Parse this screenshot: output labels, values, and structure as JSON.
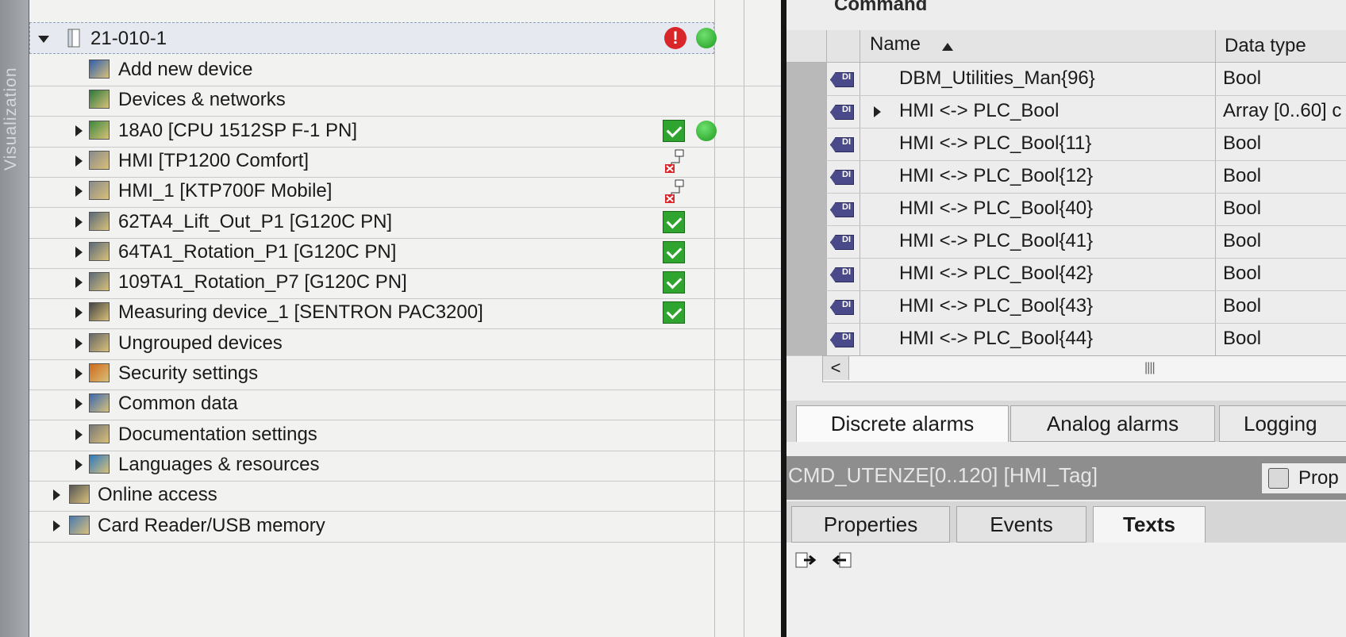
{
  "sidebar": {
    "vertical_label": "Visualization"
  },
  "tree": {
    "root": {
      "label": "21-010-1",
      "expanded": true,
      "status_error_icon": "error-icon",
      "status_online_icon": "green-dot-icon"
    },
    "items": [
      {
        "label": "Add new device",
        "icon": "add-device-icon",
        "arrow": false,
        "indent": 1,
        "status": ""
      },
      {
        "label": "Devices & networks",
        "icon": "network-icon",
        "arrow": false,
        "indent": 1,
        "status": ""
      },
      {
        "label": "18A0 [CPU 1512SP F-1 PN]",
        "icon": "cpu-icon",
        "arrow": true,
        "indent": 1,
        "status": "check-green"
      },
      {
        "label": "HMI [TP1200 Comfort]",
        "icon": "hmi-icon",
        "arrow": true,
        "indent": 1,
        "status": "net-error"
      },
      {
        "label": "HMI_1 [KTP700F Mobile]",
        "icon": "hmi-icon",
        "arrow": true,
        "indent": 1,
        "status": "net-error"
      },
      {
        "label": "62TA4_Lift_Out_P1 [G120C PN]",
        "icon": "drive-icon",
        "arrow": true,
        "indent": 1,
        "status": "check"
      },
      {
        "label": "64TA1_Rotation_P1 [G120C PN]",
        "icon": "drive-icon",
        "arrow": true,
        "indent": 1,
        "status": "check"
      },
      {
        "label": "109TA1_Rotation_P7 [G120C PN]",
        "icon": "drive-icon",
        "arrow": true,
        "indent": 1,
        "status": "check"
      },
      {
        "label": "Measuring device_1 [SENTRON PAC3200]",
        "icon": "meter-icon",
        "arrow": true,
        "indent": 1,
        "status": "check"
      },
      {
        "label": "Ungrouped devices",
        "icon": "ungrouped-icon",
        "arrow": true,
        "indent": 1,
        "status": ""
      },
      {
        "label": "Security settings",
        "icon": "security-icon",
        "arrow": true,
        "indent": 1,
        "status": ""
      },
      {
        "label": "Common data",
        "icon": "common-data-icon",
        "arrow": true,
        "indent": 1,
        "status": ""
      },
      {
        "label": "Documentation settings",
        "icon": "documentation-icon",
        "arrow": true,
        "indent": 1,
        "status": ""
      },
      {
        "label": "Languages & resources",
        "icon": "languages-icon",
        "arrow": true,
        "indent": 1,
        "status": ""
      },
      {
        "label": "Online access",
        "icon": "online-access-icon",
        "arrow": true,
        "indent": 0,
        "status": ""
      },
      {
        "label": "Card Reader/USB memory",
        "icon": "card-reader-icon",
        "arrow": true,
        "indent": 0,
        "status": ""
      }
    ]
  },
  "table": {
    "title": "Command",
    "headers": {
      "name": "Name",
      "data_type": "Data type"
    },
    "rows": [
      {
        "name": "DBM_Utilities_Man{96}",
        "type": "Bool",
        "expand": false
      },
      {
        "name": "HMI <-> PLC_Bool",
        "type": "Array [0..60] c",
        "expand": true
      },
      {
        "name": "HMI <-> PLC_Bool{11}",
        "type": "Bool",
        "expand": false
      },
      {
        "name": "HMI <-> PLC_Bool{12}",
        "type": "Bool",
        "expand": false
      },
      {
        "name": "HMI <-> PLC_Bool{40}",
        "type": "Bool",
        "expand": false
      },
      {
        "name": "HMI <-> PLC_Bool{41}",
        "type": "Bool",
        "expand": false
      },
      {
        "name": "HMI <-> PLC_Bool{42}",
        "type": "Bool",
        "expand": false
      },
      {
        "name": "HMI <-> PLC_Bool{43}",
        "type": "Bool",
        "expand": false
      },
      {
        "name": "HMI <-> PLC_Bool{44}",
        "type": "Bool",
        "expand": false
      }
    ],
    "scroll_left": "<"
  },
  "lower_tabs": [
    "Discrete alarms",
    "Analog alarms",
    "Logging"
  ],
  "properties": {
    "title": "CMD_UTENZE[0..120] [HMI_Tag]",
    "button": "Prop",
    "tabs": [
      "Properties",
      "Events",
      "Texts"
    ],
    "active_tab": "Texts"
  },
  "colors": {
    "ok_green": "#2fa52f",
    "error_red": "#d8262b",
    "tag_icon": "#4a4a8a"
  }
}
